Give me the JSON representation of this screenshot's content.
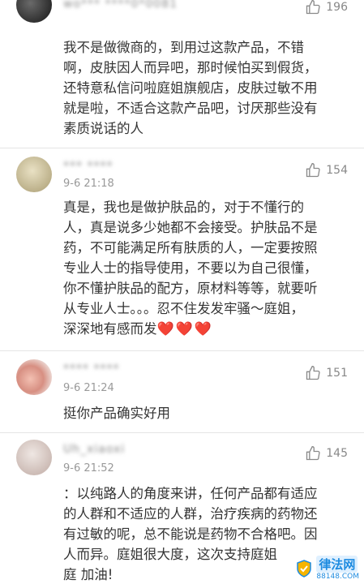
{
  "comments": [
    {
      "username": "wo*** ****0*0081",
      "likes": "196",
      "time": "",
      "lines": [
        "我不是做微商的，到用过这款产品，不错",
        "啊，皮肤因人而异吧，那时候怕买到假货，",
        "还特意私信问啦庭姐旗舰店，皮肤过敏不用",
        "就是啦，不适合这款产品吧，讨厌那些没有",
        "素质说话的人"
      ]
    },
    {
      "username": "*** ****",
      "likes": "154",
      "time": "9-6 21:18",
      "lines": [
        "真是，我也是做护肤品的，对于不懂行的",
        "人，真是说多少她都不会接受。护肤品不是",
        "药，不可能满足所有肤质的人，一定要按照",
        "专业人士的指导使用，不要以为自己很懂，",
        "你不懂护肤品的配方，原材料等等，就要听",
        "从专业人士。。。忍不住发发牢骚～庭姐，"
      ],
      "last_line": "深深地有感而发",
      "hearts": "❤️❤️❤️"
    },
    {
      "username": "**** ****",
      "likes": "151",
      "time": "9-6 21:24",
      "lines": [
        "挺你产品确实好用"
      ]
    },
    {
      "username": "Uh_xiaoxi",
      "likes": "145",
      "time": "9-6 21:52",
      "lines": [
        "：以纯路人的角度来讲，任何产品都有适应",
        "的人群和不适应的人群，治疗疾病的药物还",
        "有过敏的呢，总不能说是药物不合格吧。因",
        "人而异。庭姐很大度，这次支持庭姐",
        "庭 加油!"
      ]
    }
  ],
  "watermark": {
    "title": "律法网",
    "sub": "88148.COM"
  },
  "icons": {
    "like": "thumbs-up-icon",
    "watermark": "shield-logo-icon"
  }
}
